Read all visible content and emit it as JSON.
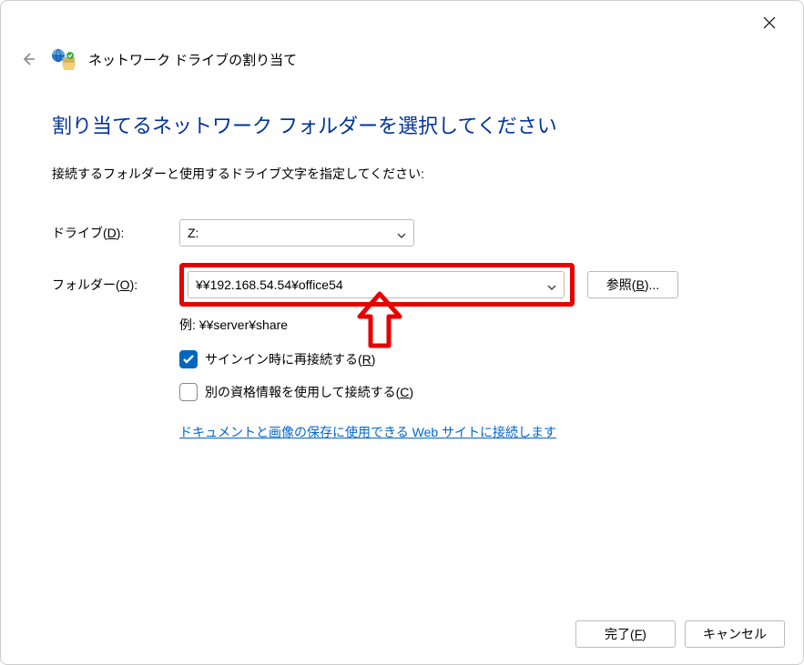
{
  "titlebar": {
    "close_tooltip": "閉じる"
  },
  "header": {
    "title": "ネットワーク ドライブの割り当て"
  },
  "main": {
    "heading": "割り当てるネットワーク フォルダーを選択してください",
    "instruction": "接続するフォルダーと使用するドライブ文字を指定してください:",
    "drive_label_prefix": "ドライブ(",
    "drive_label_key": "D",
    "drive_label_suffix": "):",
    "drive_value": "Z:",
    "folder_label_prefix": "フォルダー(",
    "folder_label_key": "O",
    "folder_label_suffix": "):",
    "folder_value": "¥¥192.168.54.54¥office54",
    "browse_prefix": "参照(",
    "browse_key": "B",
    "browse_suffix": ")...",
    "example_text": "例: ¥¥server¥share",
    "reconnect_prefix": "サインイン時に再接続する(",
    "reconnect_key": "R",
    "reconnect_suffix": ")",
    "reconnect_checked": true,
    "credentials_prefix": "別の資格情報を使用して接続する(",
    "credentials_key": "C",
    "credentials_suffix": ")",
    "credentials_checked": false,
    "web_link": "ドキュメントと画像の保存に使用できる Web サイトに接続します"
  },
  "footer": {
    "finish_prefix": "完了(",
    "finish_key": "F",
    "finish_suffix": ")",
    "cancel": "キャンセル"
  }
}
